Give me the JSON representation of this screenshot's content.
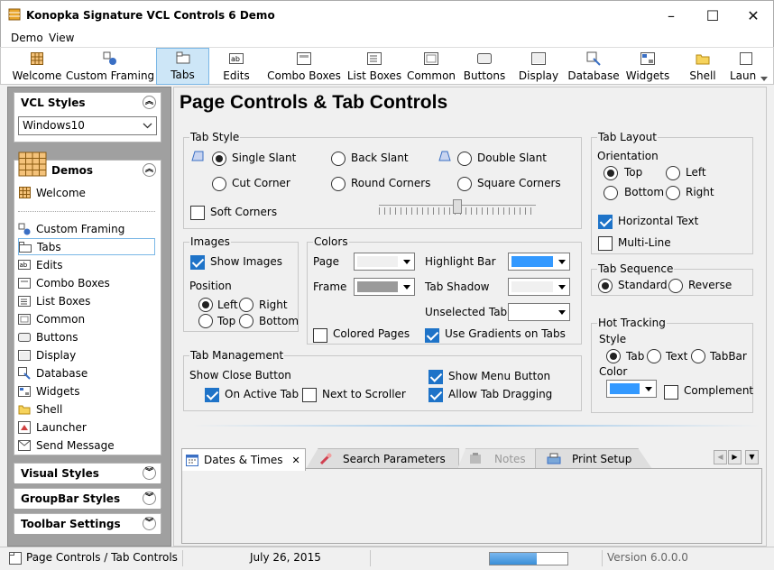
{
  "window": {
    "title": "Konopka Signature VCL Controls 6 Demo",
    "minimize": "–",
    "maximize": "☐",
    "close": "✕"
  },
  "menu": [
    "Demo",
    "View"
  ],
  "toolbar": [
    {
      "label": "Welcome",
      "icon": "grid-icon"
    },
    {
      "label": "Custom Framing",
      "icon": "framing-icon"
    },
    {
      "label": "Tabs",
      "icon": "tabs-icon"
    },
    {
      "label": "Edits",
      "icon": "edits-icon"
    },
    {
      "label": "Combo Boxes",
      "icon": "combo-icon"
    },
    {
      "label": "List Boxes",
      "icon": "listbox-icon"
    },
    {
      "label": "Common",
      "icon": "common-icon"
    },
    {
      "label": "Buttons",
      "icon": "button-icon"
    },
    {
      "label": "Display",
      "icon": "display-icon"
    },
    {
      "label": "Database",
      "icon": "database-icon"
    },
    {
      "label": "Widgets",
      "icon": "widgets-icon"
    },
    {
      "label": "Shell",
      "icon": "folder-icon"
    },
    {
      "label": "Laun",
      "icon": "launcher-icon"
    }
  ],
  "sidebar": {
    "vcl_styles": {
      "title": "VCL Styles",
      "selected": "Windows10"
    },
    "demos": {
      "title": "Demos",
      "items": [
        "Welcome",
        "Custom Framing",
        "Tabs",
        "Edits",
        "Combo Boxes",
        "List Boxes",
        "Common",
        "Buttons",
        "Display",
        "Database",
        "Widgets",
        "Shell",
        "Launcher",
        "Send Message"
      ]
    },
    "collapsed": [
      "Visual Styles",
      "GroupBar Styles",
      "Toolbar Settings"
    ]
  },
  "main": {
    "title": "Page Controls & Tab Controls",
    "tab_style": {
      "title": "Tab Style",
      "single_slant": "Single Slant",
      "back_slant": "Back Slant",
      "double_slant": "Double Slant",
      "cut_corner": "Cut Corner",
      "round_corners": "Round Corners",
      "square_corners": "Square Corners",
      "soft_corners": "Soft Corners"
    },
    "images": {
      "title": "Images",
      "show_images": "Show Images",
      "position": "Position",
      "left": "Left",
      "right": "Right",
      "top": "Top",
      "bottom": "Bottom"
    },
    "colors": {
      "title": "Colors",
      "page": "Page",
      "frame": "Frame",
      "highlight_bar": "Highlight Bar",
      "tab_shadow": "Tab Shadow",
      "unselected_tab": "Unselected Tab",
      "colored_pages": "Colored Pages",
      "use_gradients": "Use Gradients on Tabs",
      "page_color": "#f0f0f0",
      "frame_color": "#9a9a9a",
      "highlight_color": "#3399ff",
      "shadow_color": "#f0f0f0",
      "unselected_color": "#ffffff"
    },
    "tab_management": {
      "title": "Tab Management",
      "show_close": "Show Close Button",
      "on_active_tab": "On Active Tab",
      "next_to_scroller": "Next to Scroller",
      "show_menu": "Show Menu Button",
      "allow_dragging": "Allow Tab Dragging"
    },
    "tab_layout": {
      "title": "Tab Layout",
      "orientation": "Orientation",
      "top": "Top",
      "left": "Left",
      "bottom": "Bottom",
      "right": "Right",
      "horizontal_text": "Horizontal Text",
      "multi_line": "Multi-Line"
    },
    "tab_sequence": {
      "title": "Tab Sequence",
      "standard": "Standard",
      "reverse": "Reverse"
    },
    "hot_tracking": {
      "title": "Hot Tracking",
      "style": "Style",
      "tab": "Tab",
      "text": "Text",
      "tabbar": "TabBar",
      "color": "Color",
      "complement": "Complement",
      "color_value": "#3399ff"
    },
    "tabs": [
      {
        "label": "Dates & Times",
        "close": "✕"
      },
      {
        "label": "Search Parameters"
      },
      {
        "label": "Notes"
      },
      {
        "label": "Print Setup"
      }
    ]
  },
  "status": {
    "page": "Page Controls / Tab Controls",
    "date": "July 26, 2015",
    "version": "Version 6.0.0.0",
    "progress": 0.6
  }
}
